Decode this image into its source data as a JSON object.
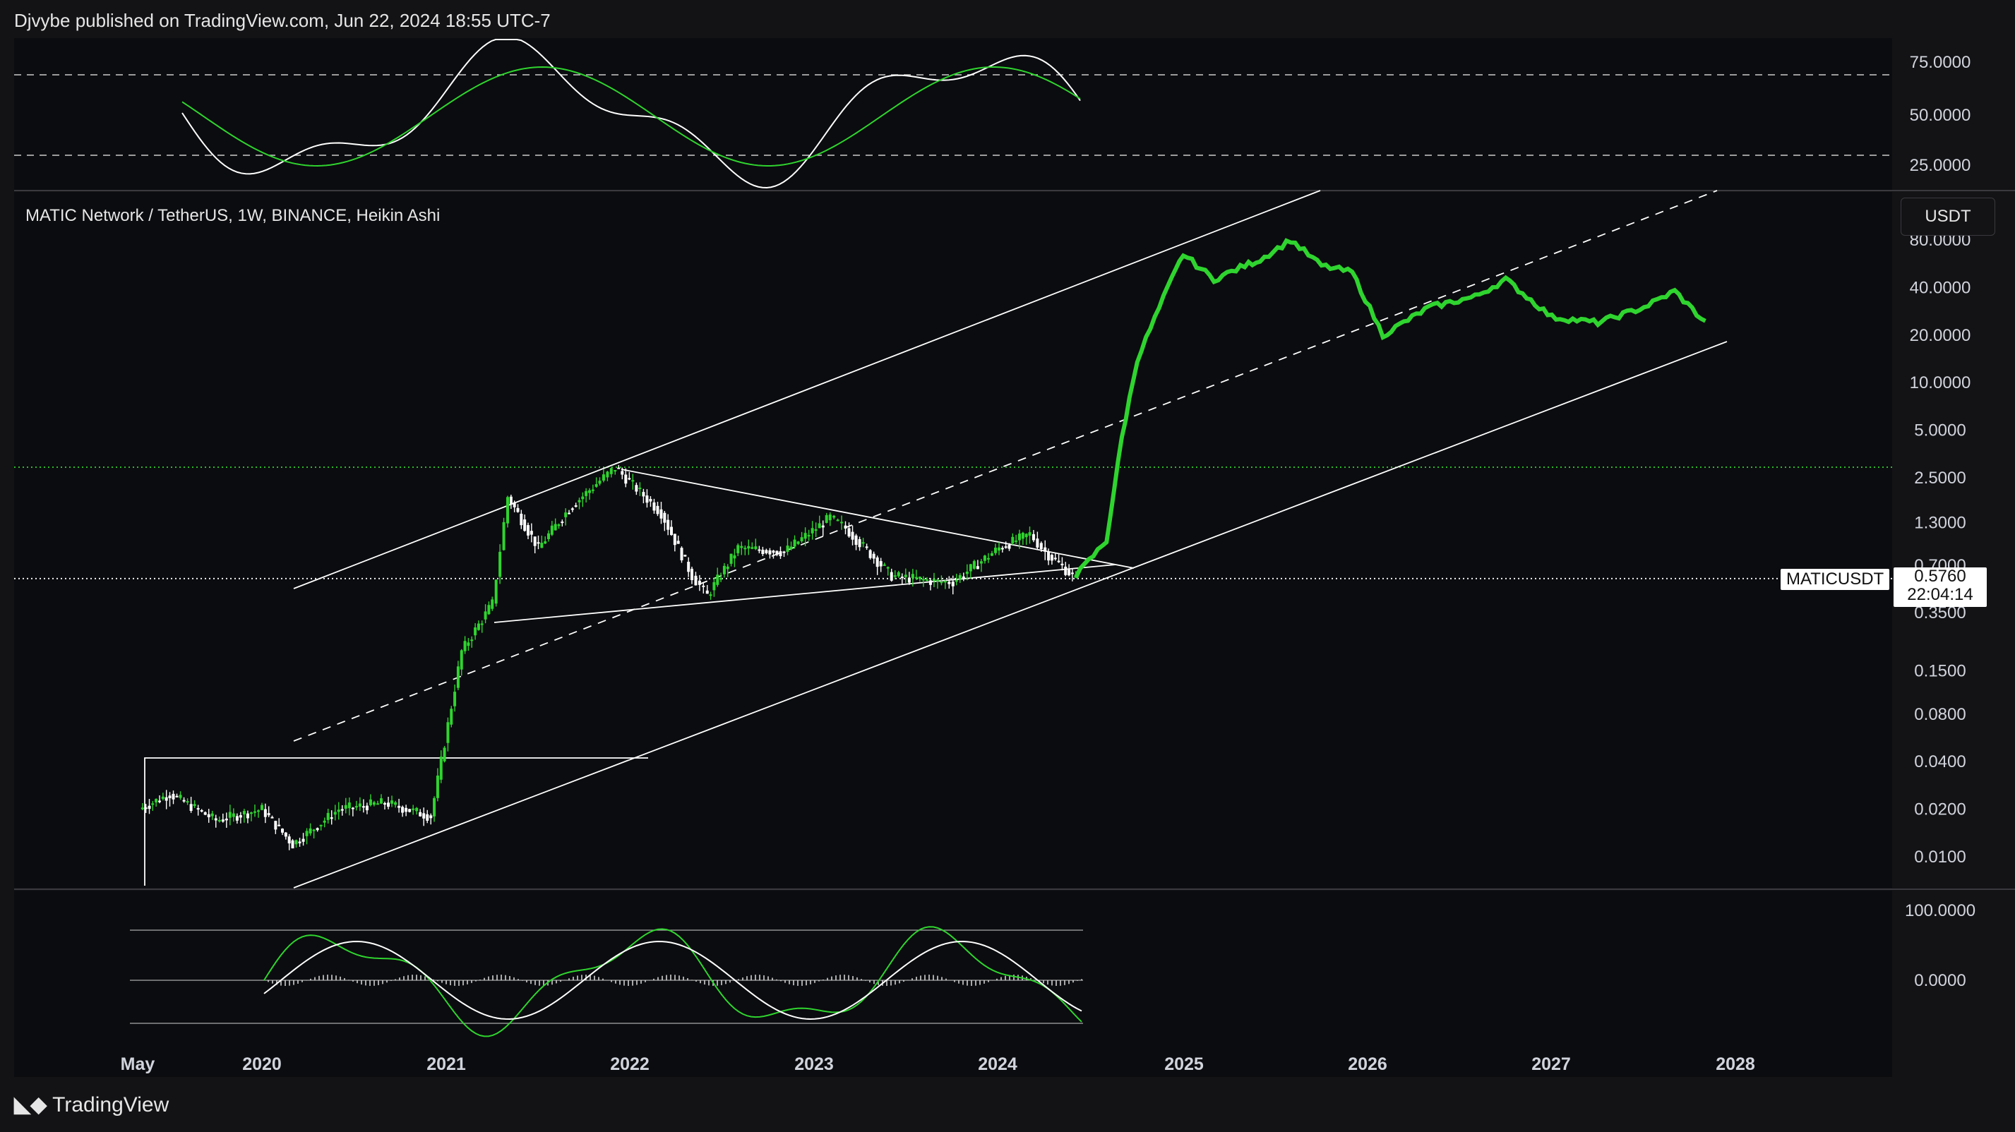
{
  "header": {
    "publisher_line": "Djvybe published on TradingView.com, Jun 22, 2024 18:55 UTC-7"
  },
  "symbol_title": "MATIC Network / TetherUS, 1W, BINANCE, Heikin Ashi",
  "currency_button": "USDT",
  "price_tag": {
    "symbol": "MATICUSDT",
    "price": "0.5760",
    "countdown": "22:04:14"
  },
  "footer": {
    "brand": "TradingView"
  },
  "colors": {
    "background": "#131316",
    "up": "#2fd42f",
    "down": "#ffffff",
    "grid": "#2a2a2e"
  },
  "chart_data": [
    {
      "type": "line",
      "name": "top-oscillator",
      "y_ticks": [
        "75.0000",
        "50.0000",
        "25.0000"
      ],
      "levels": [
        70,
        30
      ],
      "ylim": [
        10,
        90
      ]
    },
    {
      "type": "candlestick",
      "name": "price",
      "scale": "log",
      "ylim": [
        0.006,
        100
      ],
      "y_ticks": [
        "80.0000",
        "40.0000",
        "20.0000",
        "10.0000",
        "5.0000",
        "2.5000",
        "1.3000",
        "0.7000",
        "0.3500",
        "0.1500",
        "0.0800",
        "0.0400",
        "0.0200",
        "0.0100"
      ],
      "last_price": 0.576,
      "x_ticks": [
        "May",
        "2020",
        "2021",
        "2022",
        "2023",
        "2024",
        "2025",
        "2026",
        "2027",
        "2028"
      ],
      "series": [
        {
          "segment": "history",
          "x": [
            "2019-05",
            "2019-07",
            "2019-10",
            "2020-01",
            "2020-03",
            "2020-06",
            "2020-09",
            "2020-12",
            "2021-02",
            "2021-04",
            "2021-05",
            "2021-07",
            "2021-09",
            "2021-11",
            "2021-12",
            "2022-03",
            "2022-05",
            "2022-06",
            "2022-08",
            "2022-11",
            "2023-02",
            "2023-03",
            "2023-06",
            "2023-09",
            "2023-10",
            "2024-01",
            "2024-03",
            "2024-04",
            "2024-06"
          ],
          "y": [
            0.02,
            0.025,
            0.017,
            0.02,
            0.012,
            0.02,
            0.022,
            0.018,
            0.2,
            0.4,
            1.9,
            0.9,
            1.6,
            2.4,
            2.9,
            1.5,
            0.6,
            0.45,
            0.9,
            0.85,
            1.4,
            1.2,
            0.6,
            0.55,
            0.55,
            0.9,
            1.1,
            0.85,
            0.576
          ]
        },
        {
          "segment": "projection",
          "x": [
            "2024-06",
            "2024-08",
            "2024-09",
            "2024-10",
            "2024-12",
            "2025-01",
            "2025-03",
            "2025-05",
            "2025-06",
            "2025-08",
            "2025-10",
            "2025-12",
            "2026-02",
            "2026-05",
            "2026-08",
            "2026-10",
            "2027-01",
            "2027-04",
            "2027-07",
            "2027-09",
            "2027-11"
          ],
          "y": [
            0.6,
            1.0,
            4.5,
            14,
            40,
            65,
            45,
            55,
            60,
            80,
            55,
            50,
            20,
            30,
            35,
            45,
            26,
            24,
            30,
            38,
            24
          ]
        }
      ],
      "annotations": {
        "channel": "ascending parallel channel",
        "triangle": "symmetrical triangle 2021-2024",
        "box": "accumulation range 2019-2020"
      }
    },
    {
      "type": "line",
      "name": "bottom-oscillator",
      "y_ticks": [
        "100.0000",
        "0.0000"
      ],
      "ylim": [
        -100,
        100
      ]
    }
  ]
}
